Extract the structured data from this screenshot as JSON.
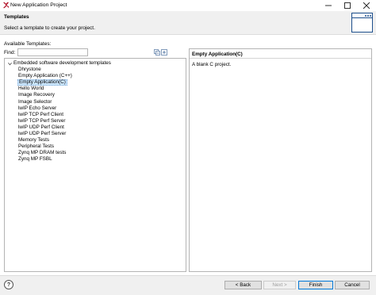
{
  "window": {
    "title": "New Application Project",
    "minimize_icon": "minimize-icon",
    "maximize_icon": "maximize-icon",
    "close_icon": "close-icon"
  },
  "banner": {
    "title": "Templates",
    "description": "Select a template to create your project.",
    "image_icon": "wizard-window-icon"
  },
  "templates": {
    "available_label": "Available Templates:",
    "find_label": "Find:",
    "find_value": "",
    "find_placeholder": "",
    "tool_icons": [
      "collapse-all-icon",
      "expand-all-icon"
    ],
    "category": "Embedded software development templates",
    "items": [
      "Dhrystone",
      "Empty Application (C++)",
      "Empty Application(C)",
      "Hello World",
      "Image Recovery",
      "Image Selector",
      "lwIP Echo Server",
      "lwIP TCP Perf Client",
      "lwIP TCP Perf Server",
      "lwIP UDP Perf Client",
      "lwIP UDP Perf Server",
      "Memory Tests",
      "Peripheral Tests",
      "Zynq MP DRAM tests",
      "Zynq MP FSBL"
    ],
    "selected_index": 2
  },
  "details": {
    "title": "Empty Application(C)",
    "description": "A blank C project."
  },
  "buttons": {
    "help_icon": "help-icon",
    "help": "?",
    "back": "< Back",
    "next": "Next >",
    "finish": "Finish",
    "cancel": "Cancel"
  },
  "colors": {
    "selection": "#cde8ff",
    "banner_bg": "#f0f0f0",
    "accent": "#0078d7"
  }
}
